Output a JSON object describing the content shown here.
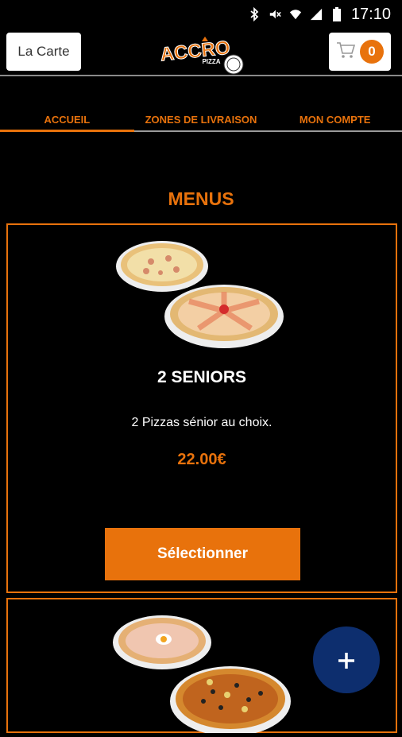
{
  "statusbar": {
    "time": "17:10",
    "icons": [
      "bluetooth-icon",
      "mute-icon",
      "wifi-icon",
      "signal-icon",
      "battery-icon"
    ]
  },
  "appbar": {
    "carte_label": "La Carte",
    "logo_text": "ACCRO",
    "logo_subtext": "PIZZA",
    "cart_count": "0"
  },
  "tabs": [
    {
      "label": "ACCUEIL",
      "active": true
    },
    {
      "label": "ZONES DE LIVRAISON",
      "active": false
    },
    {
      "label": "MON COMPTE",
      "active": false
    }
  ],
  "section_title": "MENUS",
  "menus": [
    {
      "title": "2 SENIORS",
      "description": "2 Pizzas sénior au choix.",
      "price": "22.00€",
      "button_label": "Sélectionner"
    }
  ],
  "fab_label": "+",
  "colors": {
    "accent": "#e8720c",
    "background": "#000000",
    "fab": "#0d2e6e"
  }
}
